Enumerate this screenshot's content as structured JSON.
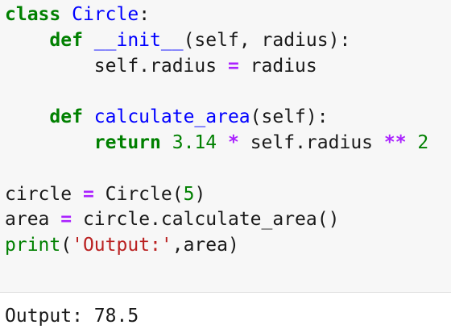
{
  "code_lines": [
    [
      [
        "kw",
        "class"
      ],
      [
        "p",
        " "
      ],
      [
        "cls",
        "Circle"
      ],
      [
        "p",
        ":"
      ]
    ],
    [
      [
        "p",
        "    "
      ],
      [
        "kw",
        "def"
      ],
      [
        "p",
        " "
      ],
      [
        "fn",
        "__init__"
      ],
      [
        "p",
        "(self, radius):"
      ]
    ],
    [
      [
        "p",
        "        self.radius "
      ],
      [
        "op",
        "="
      ],
      [
        "p",
        " radius"
      ]
    ],
    [],
    [
      [
        "p",
        "    "
      ],
      [
        "kw",
        "def"
      ],
      [
        "p",
        " "
      ],
      [
        "fn",
        "calculate_area"
      ],
      [
        "p",
        "(self):"
      ]
    ],
    [
      [
        "p",
        "        "
      ],
      [
        "kw",
        "return"
      ],
      [
        "p",
        " "
      ],
      [
        "num",
        "3.14"
      ],
      [
        "p",
        " "
      ],
      [
        "op",
        "*"
      ],
      [
        "p",
        " self.radius "
      ],
      [
        "op",
        "**"
      ],
      [
        "p",
        " "
      ],
      [
        "num",
        "2"
      ]
    ],
    [],
    [
      [
        "p",
        "circle "
      ],
      [
        "op",
        "="
      ],
      [
        "p",
        " Circle("
      ],
      [
        "num",
        "5"
      ],
      [
        "p",
        ")"
      ]
    ],
    [
      [
        "p",
        "area "
      ],
      [
        "op",
        "="
      ],
      [
        "p",
        " circle.calculate_area()"
      ]
    ],
    [
      [
        "bi",
        "print"
      ],
      [
        "p",
        "("
      ],
      [
        "str",
        "'Output:'"
      ],
      [
        "p",
        ",area)"
      ]
    ]
  ],
  "output": {
    "text": "Output: 78.5"
  },
  "colors": {
    "keyword": "#008000",
    "def_name": "#0000ff",
    "operator": "#aa22ff",
    "number": "#008000",
    "builtin": "#008000",
    "string": "#ba2121",
    "text": "#1a1a1a",
    "code_background": "#f7f7f7",
    "output_background": "#ffffff"
  }
}
